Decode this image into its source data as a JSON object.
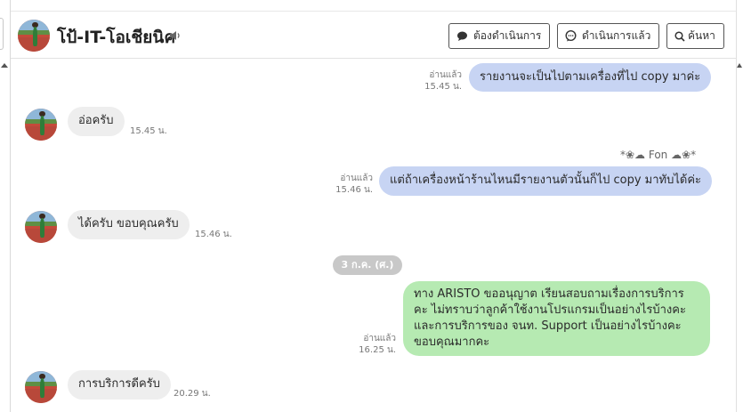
{
  "header": {
    "contact_name": "โป้-IT-โอเชียนิค",
    "buttons": {
      "todo": "ต้องดำเนินการ",
      "done": "ดำเนินการแล้ว",
      "search": "ค้นหา"
    }
  },
  "messages": [
    {
      "direction": "out",
      "text": "รายงานจะเป็นไปตามเครื่องที่ไป copy มาค่ะ",
      "read": "อ่านแล้ว",
      "time": "15.45 น."
    },
    {
      "direction": "in",
      "text": "อ่อครับ",
      "time": "15.45 น."
    },
    {
      "direction": "out",
      "sender": "*❀☁ Fon ☁❀*",
      "text": "แต่ถ้าเครื่องหน้าร้านไหนมีรายงานตัวนั้นก็ไป copy มาทับได้ค่ะ",
      "read": "อ่านแล้ว",
      "time": "15.46 น."
    },
    {
      "direction": "in",
      "text": "ได้ครับ ขอบคุณครับ",
      "time": "15.46 น."
    },
    {
      "direction": "out",
      "text": "ทาง ARISTO ขออนุญาต เรียนสอบถามเรื่องการบริการ คะ ไม่ทราบว่าลูกค้าใช้งานโปรแกรมเป็นอย่างไรบ้างคะ และการบริการของ จนท. Support เป็นอย่างไรบ้างคะ ขอบคุณมากคะ",
      "read": "อ่านแล้ว",
      "time": "16.25 น."
    },
    {
      "direction": "in",
      "text": "การบริการดีครับ",
      "time": "20.29 น."
    }
  ],
  "date_separator": "3 ก.ค. (ศ.)",
  "colors": {
    "outgoing_bubble": "#c7d4f3",
    "incoming_bubble": "#eeeeee",
    "survey_bubble": "#b6eab2",
    "date_chip": "#c8c8c8"
  }
}
